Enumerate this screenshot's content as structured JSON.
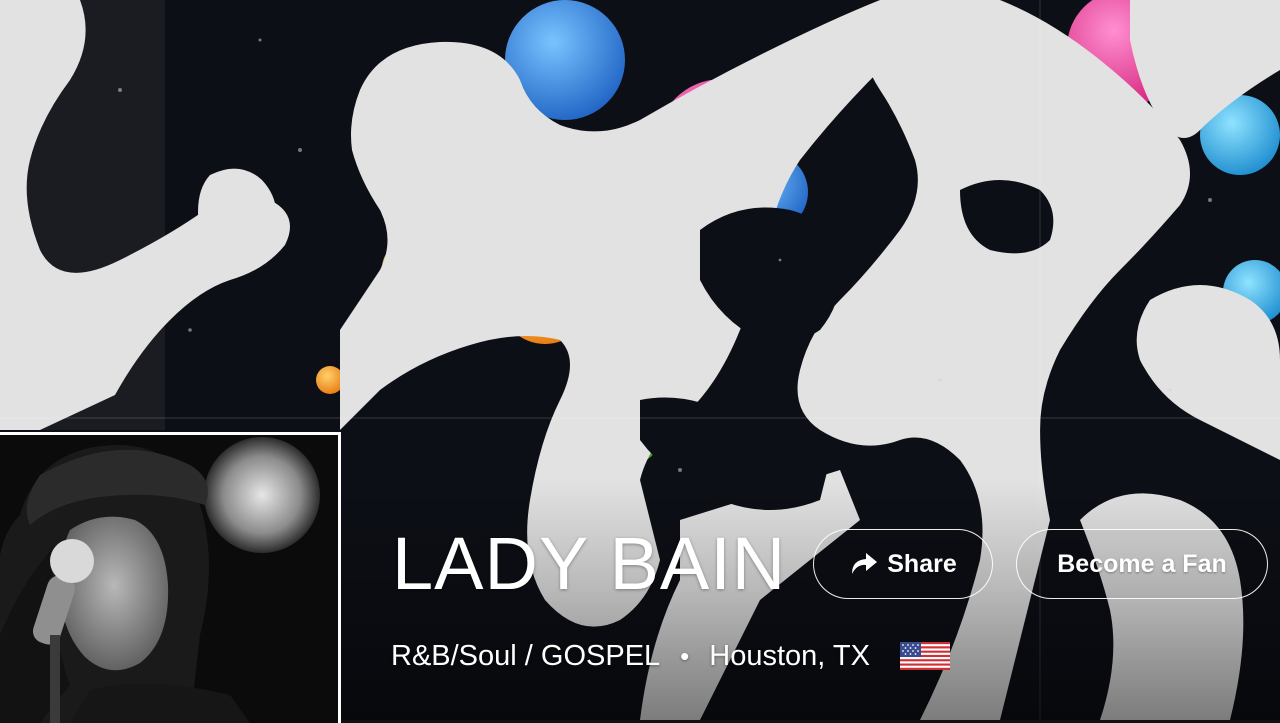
{
  "artist": {
    "name": "LADY BAIN",
    "genre": "R&B/Soul / GOSPEL",
    "separator": "•",
    "location": "Houston, TX",
    "country_flag": "us-flag-icon"
  },
  "actions": {
    "share_label": "Share",
    "fan_label": "Become a Fan"
  },
  "colors": {
    "text": "#ffffff",
    "button_border": "#ffffff",
    "cover_silhouette": "#e2e2e2",
    "cover_background": "#0d0f16",
    "balloon_pink": "#ec3c9c",
    "balloon_green": "#5fc037",
    "balloon_blue": "#2f7fd8",
    "balloon_orange": "#f39a22"
  }
}
